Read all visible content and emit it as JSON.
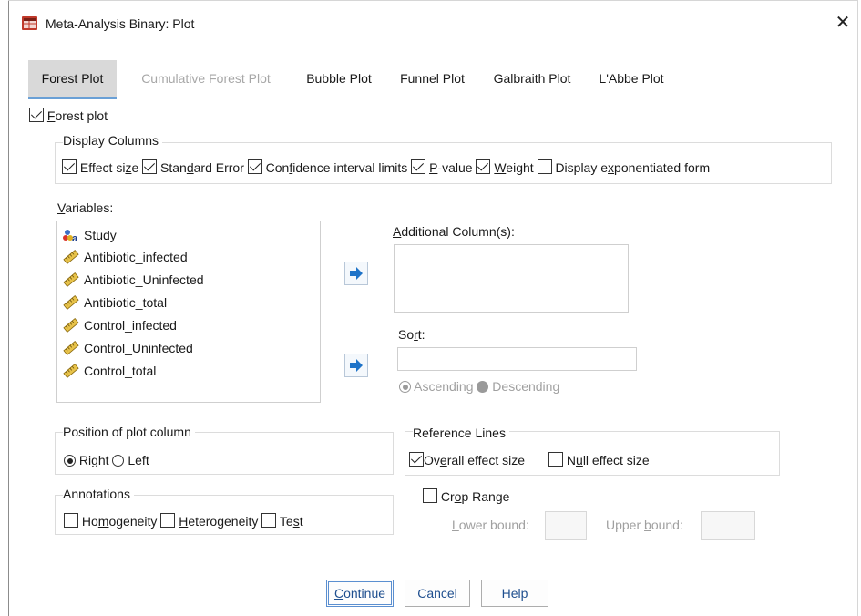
{
  "window": {
    "title": "Meta-Analysis Binary: Plot",
    "close_glyph": "✕"
  },
  "tabs": [
    {
      "label": "Forest Plot",
      "state": "active"
    },
    {
      "label": "Cumulative Forest Plot",
      "state": "disabled"
    },
    {
      "label": "Bubble Plot",
      "state": "normal"
    },
    {
      "label": "Funnel Plot",
      "state": "normal"
    },
    {
      "label": "Galbraith Plot",
      "state": "normal"
    },
    {
      "label": "L'Abbe Plot",
      "state": "normal"
    }
  ],
  "forest_plot_toggle": {
    "label_prefix": "",
    "label_mnemonic": "F",
    "label_rest": "orest plot",
    "checked": true
  },
  "display_columns": {
    "group_label": "Display Columns",
    "items": [
      {
        "pre": "Effect si",
        "mn": "z",
        "post": "e",
        "checked": true
      },
      {
        "pre": "Stan",
        "mn": "d",
        "post": "ard Error",
        "checked": true
      },
      {
        "pre": "Con",
        "mn": "f",
        "post": "idence interval limits",
        "checked": true
      },
      {
        "pre": "",
        "mn": "P",
        "post": "-value",
        "checked": true
      },
      {
        "pre": "",
        "mn": "W",
        "post": "eight",
        "checked": true
      },
      {
        "pre": "Display e",
        "mn": "x",
        "post": "ponentiated form",
        "checked": false
      }
    ]
  },
  "variables": {
    "label_mnemonic": "V",
    "label_rest": "ariables:",
    "items": [
      {
        "name": "Study",
        "icon": "nominal-string-icon"
      },
      {
        "name": "Antibiotic_infected",
        "icon": "scale-ruler-icon"
      },
      {
        "name": "Antibiotic_Uninfected",
        "icon": "scale-ruler-icon"
      },
      {
        "name": "Antibiotic_total",
        "icon": "scale-ruler-icon"
      },
      {
        "name": "Control_infected",
        "icon": "scale-ruler-icon"
      },
      {
        "name": "Control_Uninfected",
        "icon": "scale-ruler-icon"
      },
      {
        "name": "Control_total",
        "icon": "scale-ruler-icon"
      }
    ]
  },
  "additional_columns": {
    "label_mnemonic": "A",
    "label_rest": "dditional Column(s):",
    "value": ""
  },
  "sort": {
    "label_pre": "So",
    "label_mnemonic": "r",
    "label_rest": "t:",
    "value": "",
    "ascending_label": "Ascending",
    "descending_label": "Descending",
    "selected": "Ascending",
    "disabled": true
  },
  "position_of_plot_column": {
    "group_label": "Position of plot column",
    "right_label": "Right",
    "left_label": "Left",
    "selected": "Right"
  },
  "reference_lines": {
    "group_label": "Reference Lines",
    "overall": {
      "pre": "Ov",
      "mn": "e",
      "post": "rall effect size",
      "checked": true
    },
    "null": {
      "pre": "N",
      "mn": "u",
      "post": "ll effect size",
      "checked": false
    }
  },
  "annotations": {
    "group_label": "Annotations",
    "items": [
      {
        "pre": "Ho",
        "mn": "m",
        "post": "ogeneity",
        "checked": false
      },
      {
        "pre": "",
        "mn": "H",
        "post": "eterogeneity",
        "checked": false
      },
      {
        "pre": "Te",
        "mn": "s",
        "post": "t",
        "checked": false
      }
    ]
  },
  "crop_range": {
    "pre": "Cr",
    "mn": "o",
    "post": "p Range",
    "checked": false,
    "lower_pre": "",
    "lower_mn": "L",
    "lower_post": "ower bound:",
    "lower_value": "",
    "upper_pre": "Upper ",
    "upper_mn": "b",
    "upper_post": "ound:",
    "upper_value": ""
  },
  "buttons": {
    "continue": {
      "mn": "C",
      "rest": "ontinue"
    },
    "cancel": "Cancel",
    "help": "Help"
  },
  "colors": {
    "accent": "#6aa0d6",
    "arrow": "#1e73c8",
    "disabled": "#a0a0a0"
  }
}
